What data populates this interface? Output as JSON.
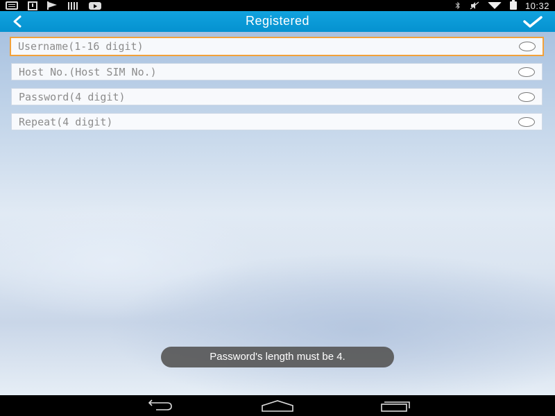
{
  "status_bar": {
    "time": "10:32",
    "left_icons": [
      "message-icon",
      "download-icon",
      "flag-icon",
      "barcode-icon",
      "video-icon"
    ],
    "right_icons": [
      "bluetooth-icon",
      "mute-icon",
      "wifi-icon",
      "battery-charging-icon"
    ]
  },
  "action_bar": {
    "title": "Registered",
    "back_icon": "chevron-left-icon",
    "confirm_icon": "checkmark-icon",
    "background_color": "#0a9ad7"
  },
  "form": {
    "fields": [
      {
        "placeholder": "Username(1-16 digit)",
        "value": ""
      },
      {
        "placeholder": "Host No.(Host SIM No.)",
        "value": ""
      },
      {
        "placeholder": "Password(4 digit)",
        "value": ""
      },
      {
        "placeholder": "Repeat(4 digit)",
        "value": ""
      }
    ],
    "focus_color": "#f2a13a"
  },
  "toast": {
    "message": "Password's length must be 4."
  },
  "nav_bar": {
    "icons": [
      "back-icon",
      "home-icon",
      "recent-apps-icon"
    ]
  }
}
